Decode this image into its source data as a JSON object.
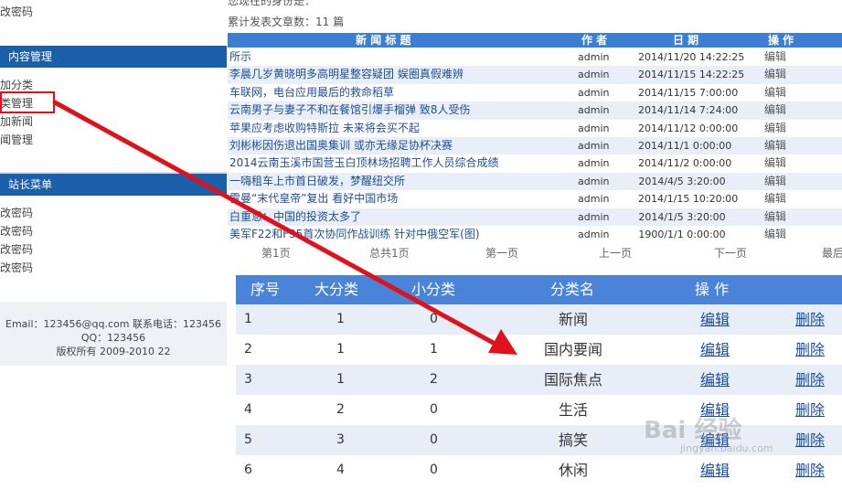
{
  "sidebar": {
    "top_link": "修改密码",
    "content_header": "内容管理",
    "content_items": [
      "添加分类",
      "分类管理",
      "添加新闻",
      "新闻管理"
    ],
    "admin_header": "站长菜单",
    "admin_items": [
      "修改密码",
      "修改密码",
      "修改密码",
      "修改密码"
    ],
    "footer": {
      "line1": "Email：123456@qq.com 联系电话：123456",
      "line2": "QQ：123456",
      "line3": "版权所有 2009-2010 22"
    }
  },
  "top": {
    "cut_text": "您现在的身份是：",
    "stat_text": "累计发表文章数：11 篇"
  },
  "news": {
    "headers": {
      "title": "新 闻 标 题",
      "author": "作 者",
      "date": "日 期",
      "op": "操 作"
    },
    "rows": [
      {
        "title": "所示",
        "author": "admin",
        "date": "2014/11/20 14:22:25",
        "op": "编辑"
      },
      {
        "title": "李晨几岁黄晓明多高明星整容疑团 娱圈真假难辨",
        "author": "admin",
        "date": "2014/11/15 14:22:25",
        "op": "编辑"
      },
      {
        "title": "车联网，电台应用最后的救命稻草",
        "author": "admin",
        "date": "2014/11/15 7:00:00",
        "op": "编辑"
      },
      {
        "title": "云南男子与妻子不和在餐馆引爆手榴弹 致8人受伤",
        "author": "admin",
        "date": "2014/11/14 7:24:00",
        "op": "编辑"
      },
      {
        "title": "苹果应考虑收购特斯拉 未来将会买不起",
        "author": "admin",
        "date": "2014/11/12 0:00:00",
        "op": "编辑"
      },
      {
        "title": "刘彬彬因伤退出国奥集训 或亦无缘足协杯决赛",
        "author": "admin",
        "date": "2014/11/1 0:00:00",
        "op": "编辑"
      },
      {
        "title": "2014云南玉溪市国营玉白顶林场招聘工作人员综合成绩",
        "author": "admin",
        "date": "2014/11/2 0:00:00",
        "op": "编辑"
      },
      {
        "title": "一嗨租车上市首日破发，梦醒纽交所",
        "author": "admin",
        "date": "2014/4/5 3:20:00",
        "op": "编辑"
      },
      {
        "title": "雷曼“末代皇帝”复出 看好中国市场",
        "author": "admin",
        "date": "2014/1/15 10:20:00",
        "op": "编辑"
      },
      {
        "title": "白重恩：中国的投资太多了",
        "author": "admin",
        "date": "2014/1/5 3:20:00",
        "op": "编辑"
      },
      {
        "title": "美军F22和F35首次协同作战训练 针对中俄空军(图)",
        "author": "admin",
        "date": "1900/1/1 0:00:00",
        "op": "编辑"
      }
    ],
    "pager": {
      "page": "第1页",
      "total": "总共1页",
      "first": "第一页",
      "prev": "上一页",
      "next": "下一页",
      "last": "最后"
    }
  },
  "categories": {
    "headers": {
      "id": "序号",
      "big": "大分类",
      "small": "小分类",
      "name": "分类名",
      "op": "操 作"
    },
    "rows": [
      {
        "id": "1",
        "big": "1",
        "small": "0",
        "name": "新闻",
        "edit": "编辑",
        "delete": "删除"
      },
      {
        "id": "2",
        "big": "1",
        "small": "1",
        "name": "国内要闻",
        "edit": "编辑",
        "delete": "删除"
      },
      {
        "id": "3",
        "big": "1",
        "small": "2",
        "name": "国际焦点",
        "edit": "编辑",
        "delete": "删除"
      },
      {
        "id": "4",
        "big": "2",
        "small": "0",
        "name": "生活",
        "edit": "编辑",
        "delete": "删除"
      },
      {
        "id": "5",
        "big": "3",
        "small": "0",
        "name": "搞笑",
        "edit": "编辑",
        "delete": "删除"
      },
      {
        "id": "6",
        "big": "4",
        "small": "0",
        "name": "休闲",
        "edit": "编辑",
        "delete": "删除"
      }
    ]
  },
  "watermark": {
    "main": "Bai 经验",
    "sub": "jingyan.baidu.com"
  },
  "colors": {
    "sidebar_header": "#1b5fa8",
    "news_header": "#3c7fd1",
    "cat_header": "#4a84d8",
    "highlight": "#e0111b",
    "link": "#1a4fa0"
  }
}
